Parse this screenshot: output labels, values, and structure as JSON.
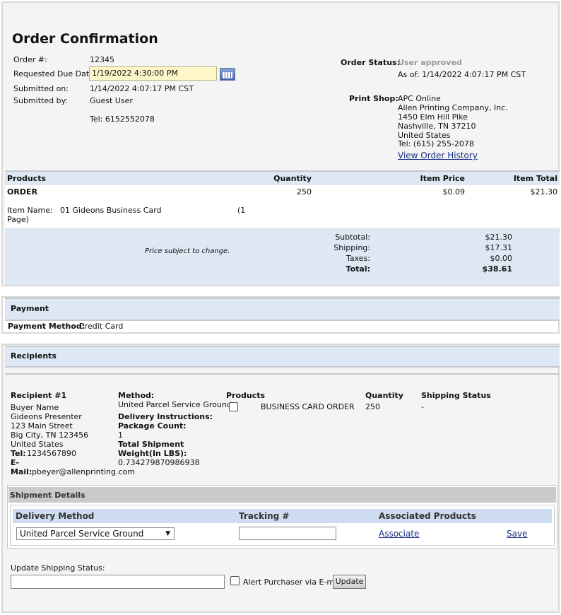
{
  "order": {
    "title": "Order Confirmation",
    "order_num_label": "Order #:",
    "order_num": "12345",
    "due_date_label": "Requested Due Date:",
    "due_date": "1/19/2022 4:30:00 PM",
    "submitted_on_label": "Submitted on:",
    "submitted_on": "1/14/2022 4:07:17 PM CST",
    "submitted_by_label": "Submitted by:",
    "submitted_by": "Guest User",
    "tel": "Tel: 6152552078",
    "status_label": "Order Status:",
    "status": "User approved",
    "as_of": "As of: 1/14/2022 4:07:17 PM CST",
    "print_shop_label": "Print Shop:",
    "print_shop_lines": [
      "APC Online",
      "Allen Printing Company, Inc.",
      "1450 Elm Hill Pike",
      "Nashville, TN 37210",
      "United States",
      "Tel: (615) 255-2078"
    ],
    "view_history": "View Order History"
  },
  "products": {
    "headers": {
      "products": "Products",
      "quantity": "Quantity",
      "item_price": "Item Price",
      "item_total": "Item Total"
    },
    "row": {
      "name": "ORDER",
      "quantity": "250",
      "item_price": "$0.09",
      "item_total": "$21.30"
    },
    "item_name_label": "Item Name:",
    "item_name": "01 Gideons Business Card",
    "item_pages_a": "(1",
    "item_pages_b": "Page)",
    "price_note": "Price subject to change.",
    "summary": {
      "subtotal_label": "Subtotal:",
      "subtotal": "$21.30",
      "shipping_label": "Shipping:",
      "shipping": "$17.31",
      "taxes_label": "Taxes:",
      "taxes": "$0.00",
      "total_label": "Total:",
      "total": "$38.61"
    }
  },
  "payment": {
    "title": "Payment",
    "method_label": "Payment Method:",
    "method": "Credit Card"
  },
  "recipients": {
    "title": "Recipients",
    "recipient_label": "Recipient #1",
    "name": "Buyer Name",
    "lines": [
      "Gideons Presenter",
      "123 Main Street",
      "Big City, TN 123456",
      "United States"
    ],
    "tel_label": "Tel:",
    "tel": "1234567890",
    "email_label_a": "E-",
    "email_label_b": "Mail:",
    "email": "pbeyer@allenprinting.com",
    "method_label": "Method:",
    "method": "United Parcel Service Ground",
    "delivery_label": "Delivery Instructions:",
    "package_label": "Package Count:",
    "package_count": "1",
    "weight_label_a": "Total Shipment",
    "weight_label_b": "Weight(In LBS):",
    "weight": "0.734279870986938",
    "products_label": "Products",
    "product_name": "BUSINESS CARD ORDER",
    "quantity_label": "Quantity",
    "quantity": "250",
    "shipping_status_label": "Shipping Status",
    "shipping_status": "-"
  },
  "shipment": {
    "title": "Shipment Details",
    "headers": {
      "delivery": "Delivery Method",
      "tracking": "Tracking #",
      "associated": "Associated Products"
    },
    "delivery_value": "United Parcel Service Ground",
    "tracking_value": "",
    "associate": "Associate",
    "save": "Save"
  },
  "update": {
    "label": "Update Shipping Status:",
    "input_value": "",
    "alert_label": "Alert Purchaser via E-mail",
    "button": "Update"
  }
}
